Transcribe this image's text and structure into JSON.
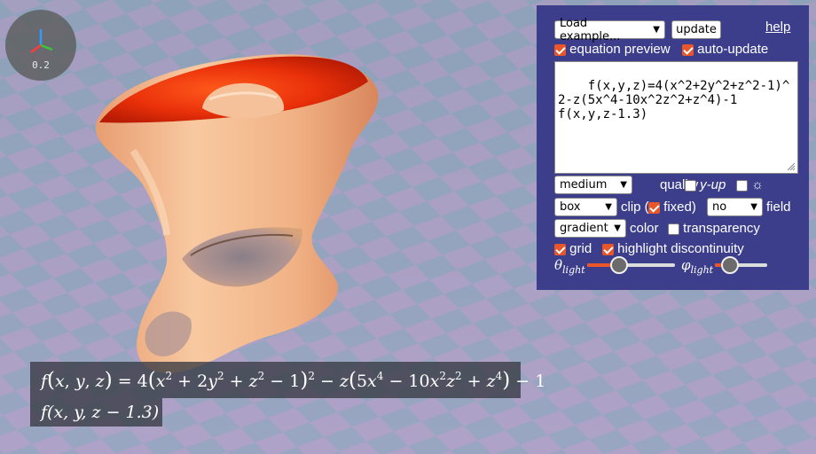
{
  "scale_widget": {
    "value": "0.2"
  },
  "equation_display": {
    "line_2": "f(x, y, z − 1.3)"
  },
  "panel": {
    "example_select": {
      "value": "Load example..."
    },
    "update_label": "update",
    "help_label": "help",
    "equation_preview": {
      "label": "equation preview",
      "checked": true
    },
    "auto_update": {
      "label": "auto-update",
      "checked": true
    },
    "code": "f(x,y,z)=4(x^2+2y^2+z^2-1)^2-z(5x^4-10x^2z^2+z^4)-1\nf(x,y,z-1.3)",
    "quality_select": {
      "value": "medium"
    },
    "quality_label": "quality",
    "y_up": {
      "label": "y-up",
      "checked": false
    },
    "sun_toggle": {
      "symbol": "☼",
      "checked": false
    },
    "clip_select": {
      "value": "box"
    },
    "clip_label": "clip (",
    "fixed": {
      "label": "fixed)",
      "checked": true
    },
    "field_select": {
      "value": "no"
    },
    "field_label": "field",
    "color_select": {
      "value": "gradient"
    },
    "color_label": "color",
    "transparency": {
      "label": "transparency",
      "checked": false
    },
    "grid": {
      "label": "grid",
      "checked": true
    },
    "highlight_discontinuity": {
      "label": "highlight discontinuity",
      "checked": true
    },
    "theta_light": {
      "symbol": "θ",
      "subscript": "light",
      "value": 0.36
    },
    "phi_light": {
      "symbol": "φ",
      "subscript": "light",
      "value": 0.28
    }
  },
  "colors": {
    "panel_bg": "#3c3e8c",
    "accent": "#e8562a",
    "checker_light": "#b3a0c8",
    "checker_dark": "#8da6bc",
    "surface": "#f0b488",
    "surface_cap": "#e22a08"
  },
  "icons": {
    "axis": "xyz-axis-gizmo",
    "resize": "resize-grip-icon",
    "sun": "sun-icon"
  }
}
